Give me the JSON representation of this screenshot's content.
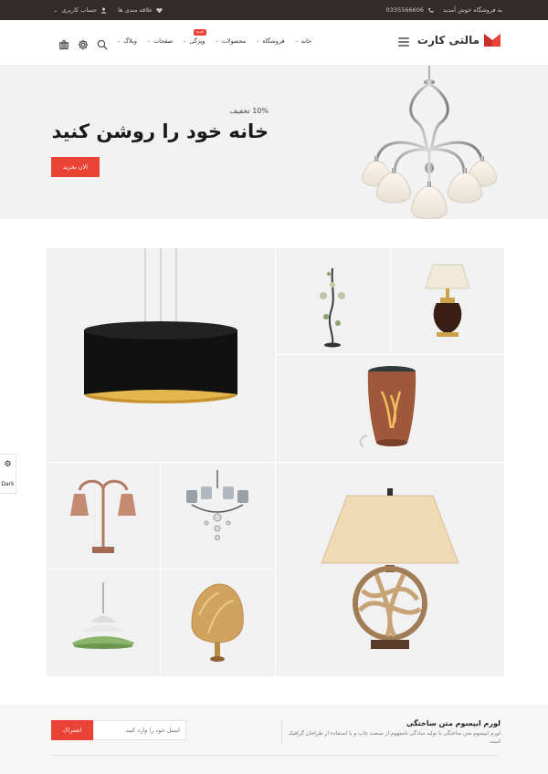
{
  "topbar": {
    "welcome": "به فروشگاه خوش آمدید",
    "phone": "0335566606",
    "wishlist": "علاقه مندی ها",
    "account": "حساب کاربری"
  },
  "header": {
    "logo_text": "مالتی کارت",
    "nav": [
      {
        "label": "خانه",
        "badge": ""
      },
      {
        "label": "فروشگاه",
        "badge": ""
      },
      {
        "label": "محصولات",
        "badge": ""
      },
      {
        "label": "ویژگی",
        "badge": "جدید"
      },
      {
        "label": "صفحات",
        "badge": ""
      },
      {
        "label": "وبلاگ",
        "badge": ""
      }
    ],
    "icons": [
      "search-icon",
      "settings-icon",
      "cart-icon",
      "menu-icon"
    ]
  },
  "hero": {
    "subtitle": "10% تخفیف",
    "title": "خانه خود را روشن کنید",
    "button": "الان بخرید"
  },
  "side_widget": {
    "label": "Dark"
  },
  "newsletter": {
    "title": "لورم ایپسوم متن ساختگی",
    "description": "لورم ایپسوم متن ساختگی با تولید سادگی نامفهوم از صنعت چاپ و با استفاده از طراحان گرافیک است",
    "placeholder": "ایمیل خود را وارد کنید",
    "button": "اشتراک"
  },
  "colors": {
    "accent": "#ea4335",
    "topbar_bg": "#332b29",
    "hero_bg": "#f2f2f3",
    "tile_bg": "#f1f1f2"
  }
}
